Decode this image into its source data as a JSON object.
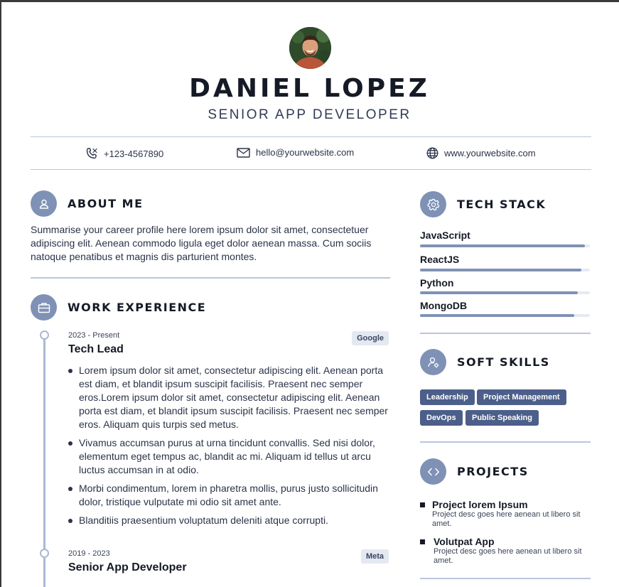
{
  "header": {
    "name": "DANIEL LOPEZ",
    "role": "SENIOR APP DEVELOPER"
  },
  "contact": {
    "phone": "+123-4567890",
    "email": "hello@yourwebsite.com",
    "website": "www.yourwebsite.com"
  },
  "about": {
    "title": "ABOUT ME",
    "text": "Summarise your career profile here lorem ipsum dolor sit amet, consectetuer adipiscing elit. Aenean commodo ligula eget dolor aenean massa. Cum sociis natoque penatibus et magnis dis parturient montes."
  },
  "work": {
    "title": "WORK EXPERIENCE",
    "jobs": [
      {
        "date": "2023 - Present",
        "title": "Tech Lead",
        "company": "Google",
        "bullets": [
          "Lorem ipsum dolor sit amet, consectetur adipiscing elit. Aenean porta est diam, et blandit ipsum suscipit facilisis. Praesent nec semper eros.Lorem ipsum dolor sit amet, consectetur adipiscing elit. Aenean porta est diam, et blandit ipsum suscipit facilisis. Praesent nec semper eros. Aliquam quis turpis sed metus.",
          "Vivamus accumsan purus at urna tincidunt convallis. Sed nisi dolor, elementum eget tempus ac, blandit ac mi. Aliquam id tellus ut arcu luctus accumsan in at odio.",
          "Morbi condimentum, lorem in pharetra mollis, purus justo sollicitudin dolor, tristique vulputate mi odio sit amet ante.",
          "Blanditiis praesentium voluptatum deleniti atque corrupti."
        ]
      },
      {
        "date": "2019 - 2023",
        "title": "Senior App Developer",
        "company": "Meta"
      }
    ]
  },
  "tech_stack": {
    "title": "TECH STACK",
    "items": [
      {
        "label": "JavaScript",
        "level": 0.97
      },
      {
        "label": "ReactJS",
        "level": 0.95
      },
      {
        "label": "Python",
        "level": 0.93
      },
      {
        "label": "MongoDB",
        "level": 0.91
      }
    ]
  },
  "soft_skills": {
    "title": "SOFT SKILLS",
    "tags": [
      "Leadership",
      "Project Management",
      "DevOps",
      "Public Speaking"
    ]
  },
  "projects": {
    "title": "PROJECTS",
    "items": [
      {
        "title": "Project lorem Ipsum",
        "desc": "Project desc goes here aenean ut libero sit amet."
      },
      {
        "title": "Volutpat App",
        "desc": "Project desc goes here aenean ut libero sit amet."
      }
    ]
  },
  "colors": {
    "accent": "#7f91b5",
    "tag_bg": "#4c5f8a",
    "divider": "#b9c6dd"
  },
  "icons": {
    "phone": "phone-icon",
    "email": "email-icon",
    "website": "globe-icon",
    "about": "user-icon",
    "work": "briefcase-icon",
    "tech": "gear-icon",
    "soft": "user-gear-icon",
    "projects": "code-icon"
  }
}
